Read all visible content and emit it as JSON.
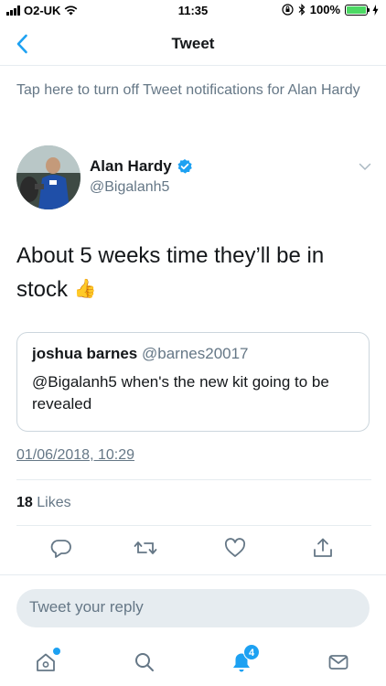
{
  "status_bar": {
    "carrier": "O2-UK",
    "time": "11:35",
    "battery": "100%",
    "battery_level": 1.0
  },
  "nav": {
    "title": "Tweet",
    "back_icon": "chevron-left-icon"
  },
  "notification_prompt": "Tap here to turn off Tweet notifications for Alan Hardy",
  "tweet": {
    "author_name": "Alan Hardy",
    "author_handle": "@Bigalanh5",
    "verified": true,
    "text": "About 5 weeks time they’ll be in stock",
    "emoji": "👍",
    "timestamp": "01/06/2018, 10:29",
    "likes_count": "18",
    "likes_label": "Likes"
  },
  "quoted_tweet": {
    "name": "joshua barnes",
    "handle": "@barnes20017",
    "text": "@Bigalanh5 when's the new kit going to be revealed"
  },
  "actions": [
    "reply-icon",
    "retweet-icon",
    "like-icon",
    "share-icon"
  ],
  "reply_bar": {
    "placeholder": "Tweet your reply"
  },
  "tabbar": {
    "notifications_badge": "4"
  },
  "colors": {
    "accent": "#1da1f2",
    "secondary_text": "#657786",
    "primary_text": "#14171a",
    "divider": "#e6ecf0",
    "battery": "#4cd964"
  }
}
